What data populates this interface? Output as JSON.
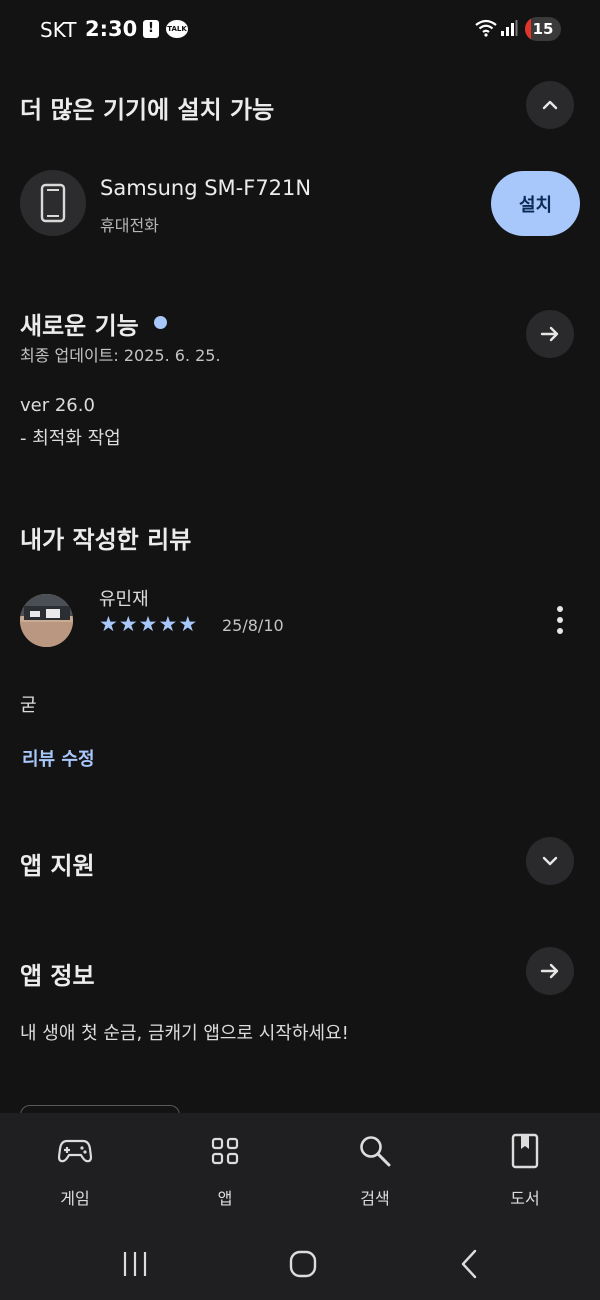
{
  "status_bar": {
    "carrier": "SKT",
    "time": "2:30",
    "alert_glyph": "!",
    "talk_label": "TALK",
    "battery_level": "15",
    "icons": [
      "alert-icon",
      "kakaotalk-icon",
      "wifi-icon",
      "signal-icon",
      "battery-icon"
    ]
  },
  "install_section": {
    "title": "더 많은 기기에 설치 가능",
    "device_name": "Samsung SM-F721N",
    "device_type": "휴대전화",
    "install_label": "설치",
    "icons": [
      "chevron-up-icon",
      "phone-icon"
    ]
  },
  "whats_new": {
    "title": "새로운 기능",
    "updated": "최종 업데이트: 2025. 6. 25.",
    "version": "ver 26.0",
    "note": "- 최적화 작업",
    "icons": [
      "arrow-right-icon"
    ]
  },
  "my_review": {
    "title": "내가 작성한 리뷰",
    "author": "유민재",
    "rating": 5,
    "stars": [
      "★",
      "★",
      "★",
      "★",
      "★"
    ],
    "date": "25/8/10",
    "text": "굳",
    "edit_label": "리뷰 수정",
    "icons": [
      "more-vert-icon"
    ]
  },
  "app_support": {
    "title": "앱 지원",
    "icons": [
      "chevron-down-icon"
    ]
  },
  "app_info": {
    "title": "앱 정보",
    "description": "내 생애 첫 순금, 금캐기 앱으로 시작하세요!",
    "icons": [
      "arrow-right-icon"
    ]
  },
  "bottom_nav": {
    "items": [
      {
        "label": "게임",
        "icon": "gamepad-icon"
      },
      {
        "label": "앱",
        "icon": "apps-grid-icon"
      },
      {
        "label": "검색",
        "icon": "search-icon"
      },
      {
        "label": "도서",
        "icon": "book-icon"
      }
    ]
  },
  "system_nav": {
    "icons": [
      "recents-icon",
      "home-icon",
      "back-icon"
    ]
  },
  "colors": {
    "background": "#131313",
    "accent": "#a8c7fa",
    "surface": "#1f1f21",
    "button_circle": "#2a2a2c"
  }
}
